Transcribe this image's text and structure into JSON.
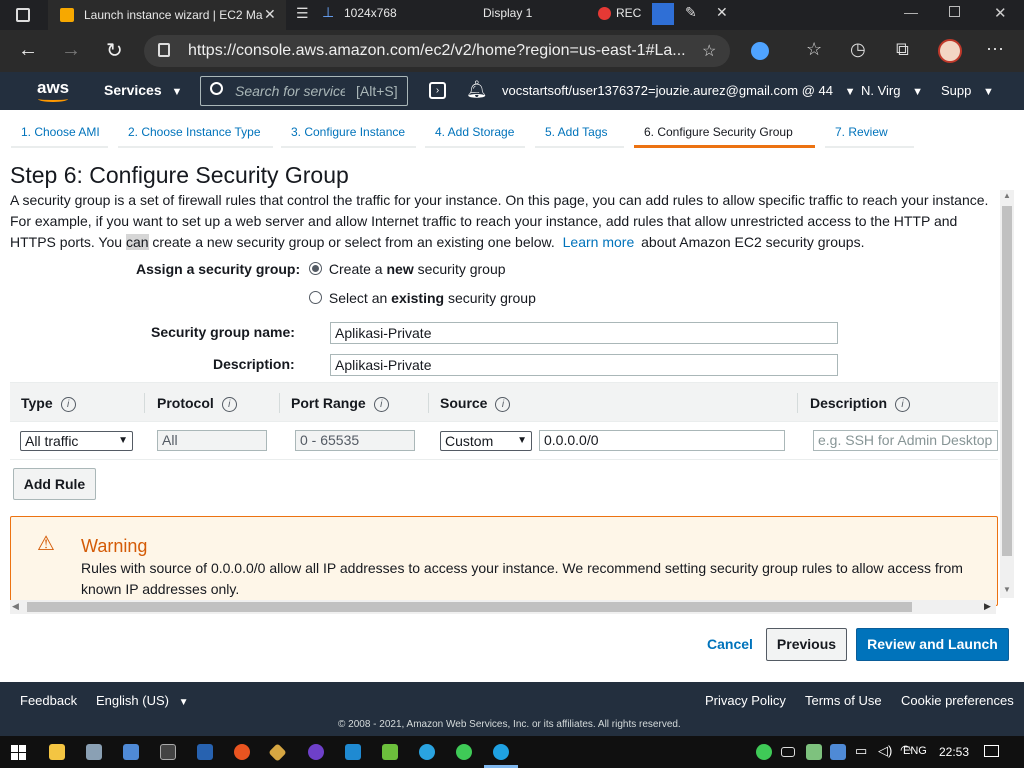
{
  "window": {
    "tab_title": "Launch instance wizard | EC2 Ma",
    "recorder_res": "1024x768",
    "display": "Display 1",
    "rec": "REC"
  },
  "browser": {
    "url": "https://console.aws.amazon.com/ec2/v2/home?region=us-east-1#La..."
  },
  "aws_nav": {
    "logo": "aws",
    "services": "Services",
    "search_placeholder": "Search for service",
    "search_shortcut": "[Alt+S]",
    "account": "vocstartsoft/user1376372=jouzie.aurez@gmail.com @ 44",
    "region": "N. Virg",
    "support": "Supp"
  },
  "steps": [
    {
      "label": "1. Choose AMI"
    },
    {
      "label": "2. Choose Instance Type"
    },
    {
      "label": "3. Configure Instance"
    },
    {
      "label": "4. Add Storage"
    },
    {
      "label": "5. Add Tags"
    },
    {
      "label": "6. Configure Security Group"
    },
    {
      "label": "7. Review"
    }
  ],
  "page": {
    "title": "Step 6: Configure Security Group",
    "desc_line1": "A security group is a set of firewall rules that control the traffic for your instance. On this page, you can add rules to allow specific traffic to reach your instance.",
    "desc_line2": "For example, if you want to set up a web server and allow Internet traffic to reach your instance, add rules that allow unrestricted access to the HTTP and",
    "desc_line3a": "HTTPS ports. You ",
    "desc_line3b": "can",
    "desc_line3c": " create a new security group or select from an existing one below.",
    "learn_more": "Learn more",
    "desc_line3d": "about Amazon EC2 security groups.",
    "assign_label": "Assign a security group:",
    "radio_create_pre": "Create a ",
    "radio_create_bold": "new",
    "radio_create_post": " security group",
    "radio_select_pre": "Select an ",
    "radio_select_bold": "existing",
    "radio_select_post": " security group",
    "sg_name_label": "Security group name:",
    "sg_name_value": "Aplikasi-Private",
    "desc_label": "Description:",
    "desc_value": "Aplikasi-Private"
  },
  "table": {
    "headers": [
      "Type",
      "Protocol",
      "Port Range",
      "Source",
      "Description"
    ],
    "row": {
      "type": "All traffic",
      "protocol": "All",
      "port_range": "0 - 65535",
      "source_type": "Custom",
      "source_value": "0.0.0.0/0",
      "description_placeholder": "e.g. SSH for Admin Desktop"
    },
    "add_rule": "Add Rule"
  },
  "warning": {
    "title": "Warning",
    "line1": "Rules with source of 0.0.0.0/0 allow all IP addresses to access your instance. We recommend setting security group rules to allow access from",
    "line2": "known IP addresses only."
  },
  "actions": {
    "cancel": "Cancel",
    "previous": "Previous",
    "review": "Review and Launch"
  },
  "footer": {
    "feedback": "Feedback",
    "language": "English (US)",
    "privacy": "Privacy Policy",
    "terms": "Terms of Use",
    "cookies": "Cookie preferences",
    "copyright": "© 2008 - 2021, Amazon Web Services, Inc. or its affiliates. All rights reserved."
  },
  "taskbar": {
    "lang": "ENG",
    "time": "22:53"
  },
  "colors": {
    "aws_nav": "#232f3e",
    "accent_orange": "#ec7211",
    "link_blue": "#0073bb",
    "primary_button": "#0073bb",
    "warning_bg": "#fef6e8"
  }
}
